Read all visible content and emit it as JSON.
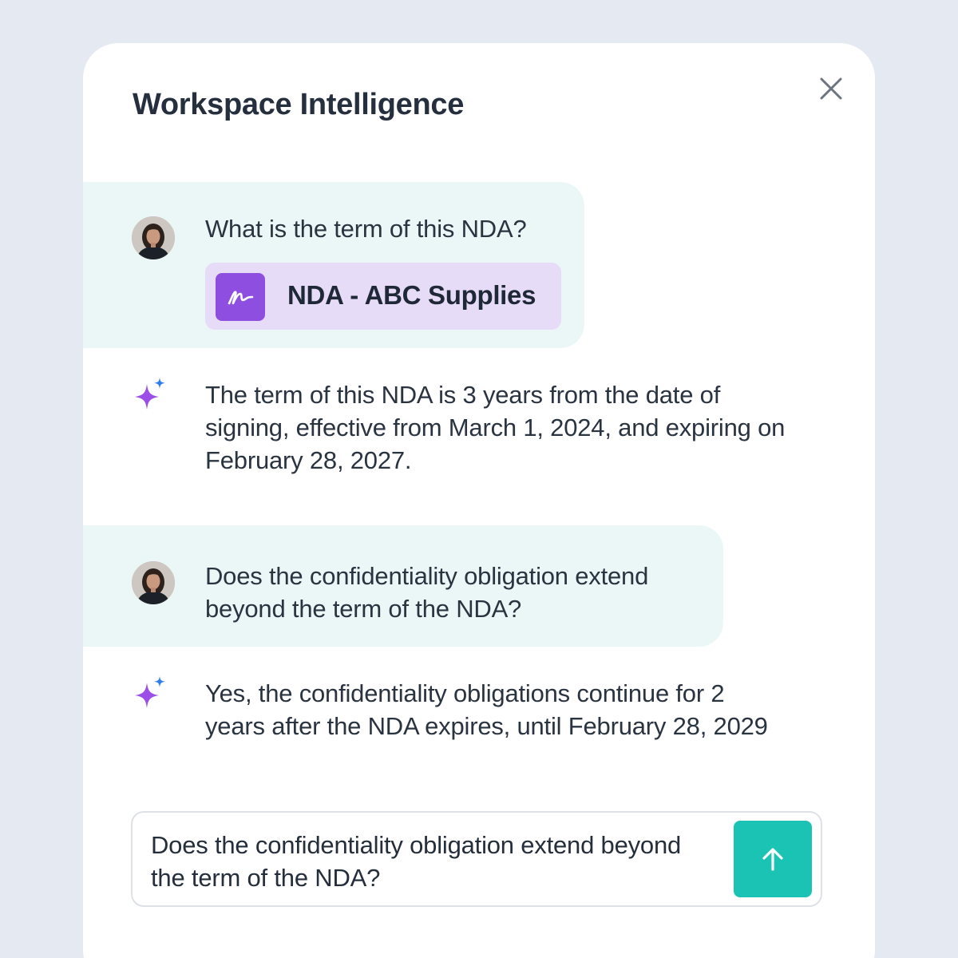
{
  "panel": {
    "title": "Workspace Intelligence",
    "close_icon": "close-icon"
  },
  "conversation": [
    {
      "role": "user",
      "avatar_icon": "user-avatar",
      "text": "What is the term of this NDA?",
      "attachment": {
        "icon": "signature-icon",
        "label": "NDA - ABC Supplies"
      }
    },
    {
      "role": "assistant",
      "icon": "sparkle-icon",
      "text": "The term of this NDA is 3 years from the date of signing, effective from March 1, 2024, and expiring on February 28, 2027."
    },
    {
      "role": "user",
      "avatar_icon": "user-avatar",
      "text": "Does the confidentiality obligation extend beyond the term of the NDA?"
    },
    {
      "role": "assistant",
      "icon": "sparkle-icon",
      "text": "Yes, the confidentiality obligations continue for 2 years after the NDA expires, until February 28, 2029"
    }
  ],
  "composer": {
    "value": "Does the confidentiality obligation extend beyond the term of the NDA?",
    "send_icon": "arrow-up-icon"
  },
  "colors": {
    "background": "#e5eaf2",
    "user_bubble": "#ebf7f7",
    "attachment_bg": "#e7dcf7",
    "attachment_icon_bg": "#8e4fe0",
    "sparkle_purple": "#9b4fe6",
    "sparkle_blue": "#2f7cf0",
    "send_button": "#1ac3b4"
  }
}
